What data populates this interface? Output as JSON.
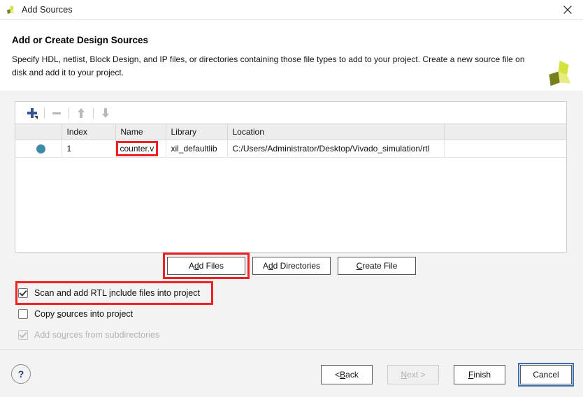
{
  "window": {
    "title": "Add Sources",
    "logo_icon": "vivado-pinwheel-icon",
    "close_icon": "close-icon"
  },
  "header": {
    "title": "Add or Create Design Sources",
    "description": "Specify HDL, netlist, Block Design, and IP files, or directories containing those file types to add to your project. Create a new source file on disk and add it to your project.",
    "logo_icon": "vivado-pinwheel-icon"
  },
  "toolbar": {
    "add_icon": "plus-icon",
    "remove_icon": "minus-icon",
    "move_up_icon": "arrow-up-icon",
    "move_down_icon": "arrow-down-icon"
  },
  "table": {
    "columns": [
      "",
      "Index",
      "Name",
      "Library",
      "Location",
      ""
    ],
    "rows": [
      {
        "status_icon": "status-dot-icon",
        "index": "1",
        "name": "counter.v",
        "library": "xil_defaultlib",
        "location": "C:/Users/Administrator/Desktop/Vivado_simulation/rtl"
      }
    ]
  },
  "mid_buttons": [
    {
      "label_pre": "A",
      "mnemonic": "d",
      "label_post": "d Files",
      "name": "add-files-button",
      "highlighted": true
    },
    {
      "label_pre": "A",
      "mnemonic": "d",
      "label_post": "d Directories",
      "name": "add-directories-button",
      "highlighted": false
    },
    {
      "label_pre": "",
      "mnemonic": "C",
      "label_post": "reate File",
      "name": "create-file-button",
      "highlighted": false
    }
  ],
  "checkboxes": [
    {
      "label_pre": "Scan and add RTL ",
      "mnemonic": "i",
      "label_post": "nclude files into project",
      "checked": true,
      "enabled": true,
      "highlighted": true
    },
    {
      "label_pre": "Copy ",
      "mnemonic": "s",
      "label_post": "ources into project",
      "checked": false,
      "enabled": true,
      "highlighted": false
    },
    {
      "label_pre": "Add so",
      "mnemonic": "u",
      "label_post": "rces from subdirectories",
      "checked": true,
      "enabled": false,
      "highlighted": false
    }
  ],
  "footer": {
    "help_label": "?",
    "buttons": [
      {
        "label_pre": "< ",
        "mnemonic": "B",
        "label_post": "ack",
        "name": "back-button",
        "disabled": false,
        "focused": false
      },
      {
        "label_pre": "",
        "mnemonic": "N",
        "label_post": "ext >",
        "name": "next-button",
        "disabled": true,
        "focused": false
      },
      {
        "label_pre": "",
        "mnemonic": "F",
        "label_post": "inish",
        "name": "finish-button",
        "disabled": false,
        "focused": false
      },
      {
        "label_pre": "Cancel",
        "mnemonic": "",
        "label_post": "",
        "name": "cancel-button",
        "disabled": false,
        "focused": true
      }
    ]
  },
  "colors": {
    "accent_blue": "#3d6fb8",
    "highlight_red": "#ee2222",
    "status_dot": "#3e8ba9",
    "logo_light": "#d6e23c",
    "logo_dark": "#77801c",
    "window_bg": "#f3f3f3"
  }
}
